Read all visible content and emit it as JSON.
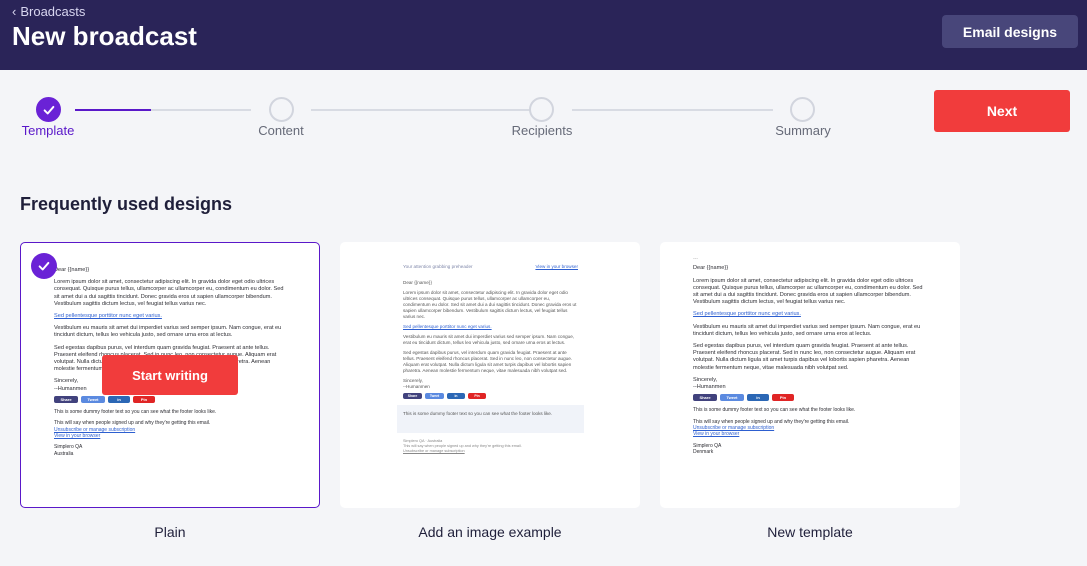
{
  "header": {
    "breadcrumb": "Broadcasts",
    "title": "New broadcast",
    "designs_button": "Email designs"
  },
  "steps": [
    {
      "label": "Template",
      "state": "complete"
    },
    {
      "label": "Content",
      "state": "pending"
    },
    {
      "label": "Recipients",
      "state": "pending"
    },
    {
      "label": "Summary",
      "state": "pending"
    }
  ],
  "next_button": "Next",
  "section_title": "Frequently used designs",
  "colors": {
    "header_bg": "#2a2458",
    "accent": "#6a22d6",
    "primary_button": "#f13c3c"
  },
  "cards": [
    {
      "name": "Plain",
      "selected": true,
      "action": "Start writing",
      "preview": {
        "greeting": "Dear {{name}}",
        "para1": "Lorem ipsum dolor sit amet, consectetur adipiscing elit. In gravida dolor eget odio ultrices consequat. Quisque purus tellus, ullamcorper ac ullamcorper eu, condimentum eu dolor. Sed sit amet dui a dui sagittis tincidunt. Donec gravida eros ut sapien ullamcorper bibendum. Vestibulum sagittis dictum lectus, vel feugiat tellus varius nec.",
        "link": "Sed pellentesque porttitor nunc eget varius.",
        "para2": "Vestibulum eu mauris sit amet dui imperdiet varius sed semper ipsum. Nam congue, erat eu tincidunt dictum, tellus leo vehicula justo, sed ornare urna eros at lectus.",
        "para3": "Sed egestas dapibus purus, vel interdum quam gravida feugiat. Praesent at ante tellus. Praesent eleifend rhoncus placerat. Sed in nunc leo, non consectetur augue. Aliquam erat volutpat. Nulla dictum ligula sit amet turpis dapibus vel lobortis sapien pharetra. Aenean molestie fermentum neque, vitae malesuada nibh volutpat sed.",
        "signoff": "Sincerely,",
        "signature": "--Humanmen",
        "share": [
          "Share",
          "Tweet",
          "in",
          "Pin"
        ],
        "footer_text": "This is some dummy footer text so you can see what the footer looks like.",
        "why": "This will say when people signed up and why they're getting this email.",
        "unsubscribe": "Unsubscribe or manage subscription",
        "view_browser": "View in your browser",
        "company": "Simplero QA",
        "country": "Australia"
      }
    },
    {
      "name": "Add an image example",
      "selected": false,
      "preview": {
        "preheader": "Your attention grabbing preheader",
        "view_link": "View in your browser",
        "greeting": "Dear {{name}}",
        "para1": "Lorem ipsum dolor sit amet, consectetur adipiscing elit. In gravida dolor eget odio ultrices consequat. Quisque purus tellus, ullamcorper ac ullamcorper eu, condimentum eu dolor. Sed sit amet dui a dui sagittis tincidunt. Donec gravida eros ut sapien ullamcorper bibendum. Vestibulum sagittis dictum lectus, vel feugiat tellus varius nec.",
        "link": "Sed pellentesque porttitor nunc eget varius.",
        "para2": "Vestibulum eu mauris sit amet dui imperdiet varius sed semper ipsum. Nam congue, erat eu tincidunt dictum, tellus leo vehicula justo, sed ornare urna eros at lectus.",
        "para3": "Sed egestas dapibus purus, vel interdum quam gravida feugiat. Praesent at ante tellus. Praesent eleifend rhoncus placerat. Sed in nunc leo, non consectetur augue. Aliquam erat volutpat. Nulla dictum ligula sit amet turpis dapibus vel lobortis sapien pharetra. Aenean molestie fermentum neque, vitae malesuada nibh volutpat sed.",
        "signoff": "Sincerely,",
        "signature": "--Humanmen",
        "share": [
          "Share",
          "Tweet",
          "in",
          "Pin"
        ],
        "footer_text": "This is some dummy footer text so you can see what the footer looks like.",
        "company": "Simplero QA · Australia",
        "why": "This will say when people signed up and why they're getting this email.",
        "unsubscribe": "Unsubscribe or manage subscription"
      }
    },
    {
      "name": "New template",
      "selected": false,
      "preview": {
        "dash": "---",
        "greeting": "Dear {{name}}",
        "para1": "Lorem ipsum dolor sit amet, consectetur adipiscing elit. In gravida dolor eget odio ultrices consequat. Quisque purus tellus, ullamcorper ac ullamcorper eu, condimentum eu dolor. Sed sit amet dui a dui sagittis tincidunt. Donec gravida eros ut sapien ullamcorper bibendum. Vestibulum sagittis dictum lectus, vel feugiat tellus varius nec.",
        "link": "Sed pellentesque porttitor nunc eget varius.",
        "para2": "Vestibulum eu mauris sit amet dui imperdiet varius sed semper ipsum. Nam congue, erat eu tincidunt dictum, tellus leo vehicula justo, sed ornare urna eros at lectus.",
        "para3": "Sed egestas dapibus purus, vel interdum quam gravida feugiat. Praesent at ante tellus. Praesent eleifend rhoncus placerat. Sed in nunc leo, non consectetur augue. Aliquam erat volutpat. Nulla dictum ligula sit amet turpis dapibus vel lobortis sapien pharetra. Aenean molestie fermentum neque, vitae malesuada nibh volutpat sed.",
        "signoff": "Sincerely,",
        "signature": "--Humanmen",
        "share": [
          "Share",
          "Tweet",
          "in",
          "Pin"
        ],
        "footer_text": "This is some dummy footer text so you can see what the footer looks like.",
        "why": "This will say when people signed up and why they're getting this email.",
        "unsubscribe": "Unsubscribe or manage subscription",
        "view_browser": "View in your browser",
        "company": "Simplero QA",
        "country": "Denmark"
      }
    }
  ]
}
